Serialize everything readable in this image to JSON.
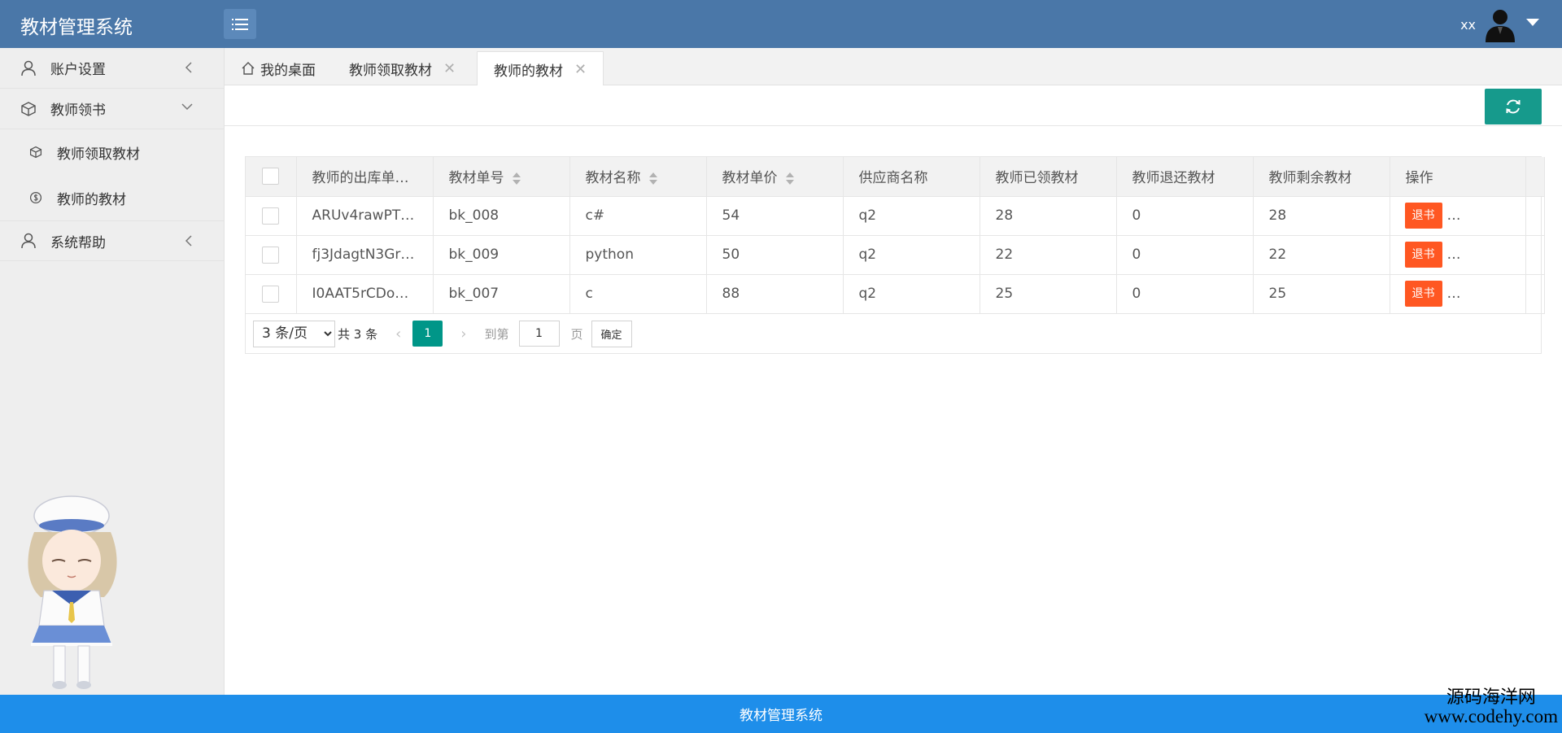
{
  "header": {
    "app_title": "教材管理系统",
    "username": "xx"
  },
  "sidebar": {
    "items": [
      {
        "label": "账户设置"
      },
      {
        "label": "教师领书"
      },
      {
        "label": "教师领取教材"
      },
      {
        "label": "教师的教材"
      },
      {
        "label": "系统帮助"
      }
    ]
  },
  "tabs": [
    {
      "label": "我的桌面"
    },
    {
      "label": "教师领取教材"
    },
    {
      "label": "教师的教材"
    }
  ],
  "table": {
    "columns": [
      "教师的出库单…",
      "教材单号",
      "教材名称",
      "教材单价",
      "供应商名称",
      "教师已领教材",
      "教师退还教材",
      "教师剩余教材",
      "操作"
    ],
    "rows": [
      {
        "id": "ARUv4rawPT…",
        "book_no": "bk_008",
        "name": "c#",
        "price": "54",
        "supplier": "q2",
        "received": "28",
        "returned": "0",
        "remaining": "28"
      },
      {
        "id": "fj3JdagtN3Gr…",
        "book_no": "bk_009",
        "name": "python",
        "price": "50",
        "supplier": "q2",
        "received": "22",
        "returned": "0",
        "remaining": "22"
      },
      {
        "id": "I0AAT5rCDo…",
        "book_no": "bk_007",
        "name": "c",
        "price": "88",
        "supplier": "q2",
        "received": "25",
        "returned": "0",
        "remaining": "25"
      }
    ],
    "action_label": "退书",
    "more_label": "…"
  },
  "pager": {
    "page_size": "3 条/页",
    "total": "共 3 条",
    "current": "1",
    "goto_label": "到第",
    "goto_value": "1",
    "page_label": "页",
    "confirm": "确定"
  },
  "footer": {
    "text": "教材管理系统"
  },
  "watermark": {
    "line1": "源码海洋网",
    "line2": "www.codehy.com"
  },
  "colors": {
    "header": "#4a77a8",
    "footer": "#1e8eea",
    "accent": "#009688",
    "danger": "#ff5722"
  }
}
